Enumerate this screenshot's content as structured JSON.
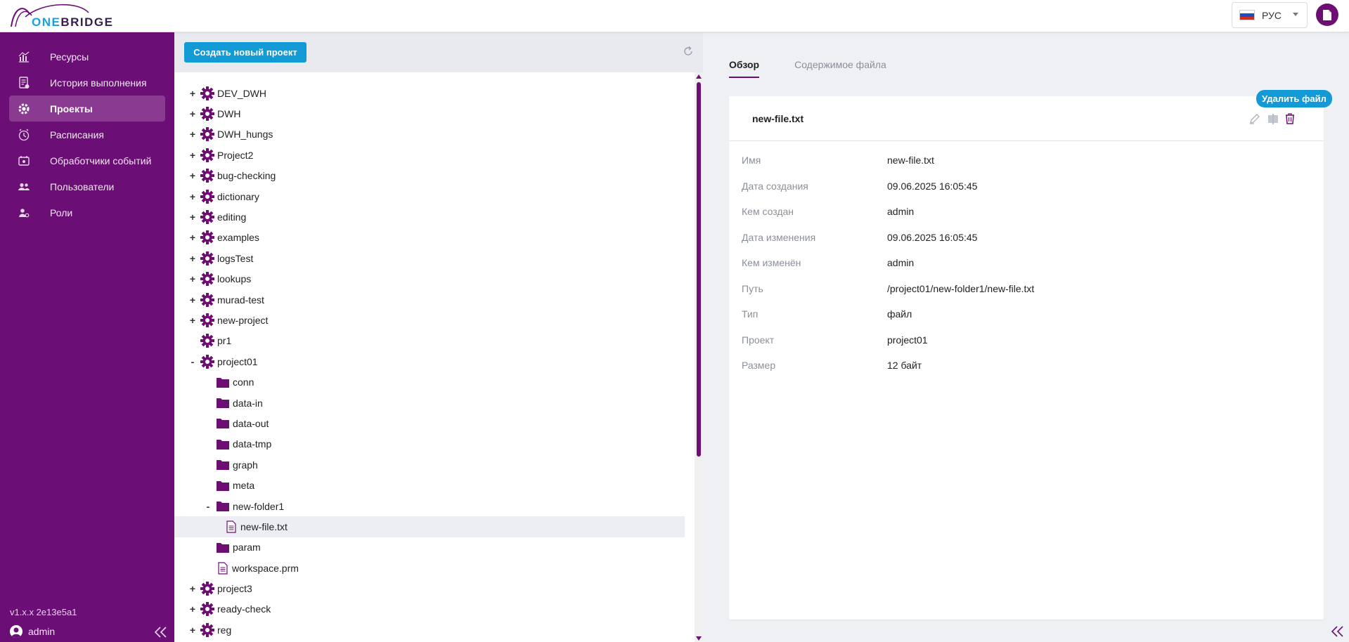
{
  "header": {
    "logo_one": "ONE",
    "logo_bridge": "BRIDGE",
    "language_label": "РУС",
    "flag_colors": [
      "#ffffff",
      "#1c4fb8",
      "#d52b1e"
    ],
    "doc_button_icon": "document-icon"
  },
  "sidebar": {
    "items": [
      {
        "label": "Ресурсы",
        "icon": "chart-icon"
      },
      {
        "label": "История выполнения",
        "icon": "history-icon"
      },
      {
        "label": "Проекты",
        "icon": "gears-icon",
        "active": true
      },
      {
        "label": "Расписания",
        "icon": "clock-icon"
      },
      {
        "label": "Обработчики событий",
        "icon": "calendar-icon"
      },
      {
        "label": "Пользователи",
        "icon": "users-icon"
      },
      {
        "label": "Роли",
        "icon": "role-icon"
      }
    ],
    "version": "v1.x.x 2e13e5a1",
    "user": "admin"
  },
  "toolbar": {
    "create_project": "Создать новый проект"
  },
  "tree": [
    {
      "level": 0,
      "toggle": "+",
      "type": "project",
      "label": "DEV_DWH"
    },
    {
      "level": 0,
      "toggle": "+",
      "type": "project",
      "label": "DWH"
    },
    {
      "level": 0,
      "toggle": "+",
      "type": "project",
      "label": "DWH_hungs"
    },
    {
      "level": 0,
      "toggle": "+",
      "type": "project",
      "label": "Project2"
    },
    {
      "level": 0,
      "toggle": "+",
      "type": "project",
      "label": "bug-checking"
    },
    {
      "level": 0,
      "toggle": "+",
      "type": "project",
      "label": "dictionary"
    },
    {
      "level": 0,
      "toggle": "+",
      "type": "project",
      "label": "editing"
    },
    {
      "level": 0,
      "toggle": "+",
      "type": "project",
      "label": "examples"
    },
    {
      "level": 0,
      "toggle": "+",
      "type": "project",
      "label": "logsTest"
    },
    {
      "level": 0,
      "toggle": "+",
      "type": "project",
      "label": "lookups"
    },
    {
      "level": 0,
      "toggle": "+",
      "type": "project",
      "label": "murad-test"
    },
    {
      "level": 0,
      "toggle": "+",
      "type": "project",
      "label": "new-project"
    },
    {
      "level": 0,
      "toggle": "",
      "type": "project",
      "label": "pr1"
    },
    {
      "level": 0,
      "toggle": "-",
      "type": "project",
      "label": "project01"
    },
    {
      "level": 1,
      "toggle": "",
      "type": "folder",
      "label": "conn"
    },
    {
      "level": 1,
      "toggle": "",
      "type": "folder",
      "label": "data-in"
    },
    {
      "level": 1,
      "toggle": "",
      "type": "folder",
      "label": "data-out"
    },
    {
      "level": 1,
      "toggle": "",
      "type": "folder",
      "label": "data-tmp"
    },
    {
      "level": 1,
      "toggle": "",
      "type": "folder",
      "label": "graph"
    },
    {
      "level": 1,
      "toggle": "",
      "type": "folder",
      "label": "meta"
    },
    {
      "level": 1,
      "toggle": "-",
      "type": "folder",
      "label": "new-folder1"
    },
    {
      "level": 2,
      "toggle": "",
      "type": "file",
      "label": "new-file.txt",
      "selected": true
    },
    {
      "level": 1,
      "toggle": "",
      "type": "folder",
      "label": "param"
    },
    {
      "level": 1,
      "toggle": "",
      "type": "file",
      "label": "workspace.prm"
    },
    {
      "level": 0,
      "toggle": "+",
      "type": "project",
      "label": "project3"
    },
    {
      "level": 0,
      "toggle": "+",
      "type": "project",
      "label": "ready-check"
    },
    {
      "level": 0,
      "toggle": "+",
      "type": "project",
      "label": "reg"
    }
  ],
  "tabs": {
    "overview": "Обзор",
    "content": "Содержимое файла"
  },
  "details": {
    "title": "new-file.txt",
    "delete_tooltip": "Удалить файл",
    "properties": [
      {
        "key": "Имя",
        "value": "new-file.txt"
      },
      {
        "key": "Дата создания",
        "value": "09.06.2025 16:05:45"
      },
      {
        "key": "Кем создан",
        "value": "admin"
      },
      {
        "key": "Дата изменения",
        "value": "09.06.2025 16:05:45"
      },
      {
        "key": "Кем изменён",
        "value": "admin"
      },
      {
        "key": "Путь",
        "value": "/project01/new-folder1/new-file.txt"
      },
      {
        "key": "Тип",
        "value": "файл"
      },
      {
        "key": "Проект",
        "value": "project01"
      },
      {
        "key": "Размер",
        "value": "12 байт"
      }
    ]
  },
  "colors": {
    "sidebar": "#6b0e75",
    "accent": "#6d0e73",
    "primary_button": "#129ad6"
  }
}
